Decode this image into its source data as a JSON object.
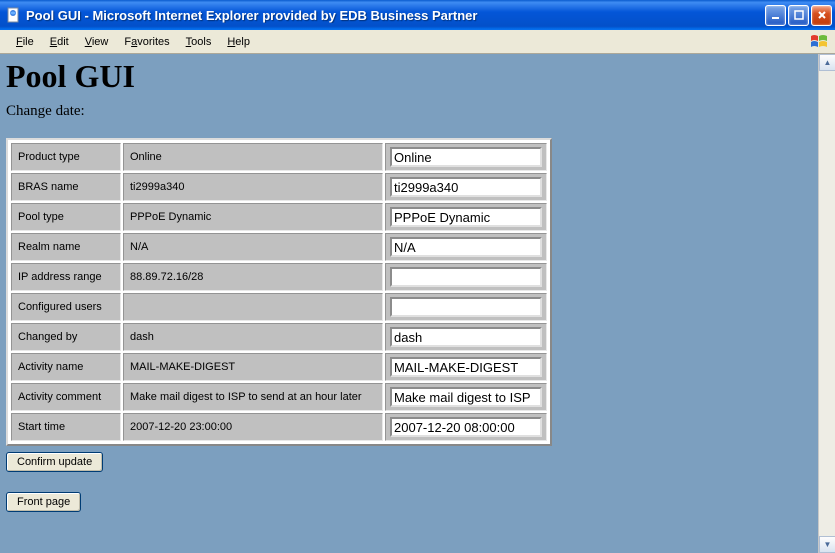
{
  "window": {
    "title": "Pool GUI - Microsoft Internet Explorer provided by EDB Business Partner"
  },
  "menubar": {
    "file": "File",
    "edit": "Edit",
    "view": "View",
    "favorites": "Favorites",
    "tools": "Tools",
    "help": "Help"
  },
  "page": {
    "title": "Pool GUI",
    "subtitle": "Change date:"
  },
  "rows": [
    {
      "label": "Product type",
      "value": "Online",
      "input": "Online"
    },
    {
      "label": "BRAS name",
      "value": "ti2999a340",
      "input": "ti2999a340"
    },
    {
      "label": "Pool type",
      "value": "PPPoE Dynamic",
      "input": "PPPoE Dynamic"
    },
    {
      "label": "Realm name",
      "value": "N/A",
      "input": "N/A"
    },
    {
      "label": "IP address range",
      "value": "88.89.72.16/28",
      "input": ""
    },
    {
      "label": "Configured users",
      "value": "",
      "input": ""
    },
    {
      "label": "Changed by",
      "value": "dash",
      "input": "dash"
    },
    {
      "label": "Activity name",
      "value": "MAIL-MAKE-DIGEST",
      "input": "MAIL-MAKE-DIGEST"
    },
    {
      "label": "Activity comment",
      "value": "Make mail digest to ISP to send at an hour later",
      "input": "Make mail digest to ISP"
    },
    {
      "label": "Start time",
      "value": "2007-12-20 23:00:00",
      "input": "2007-12-20 08:00:00"
    }
  ],
  "buttons": {
    "confirm": "Confirm update",
    "front": "Front page"
  }
}
